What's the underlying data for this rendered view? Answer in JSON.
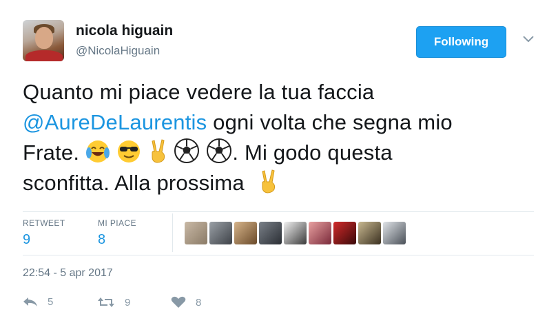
{
  "user": {
    "name": "nicola higuain",
    "handle": "@NicolaHiguain"
  },
  "follow_button": {
    "label": "Following"
  },
  "tweet": {
    "seg1": "Quanto mi piace vedere la tua faccia",
    "mention": "@AureDeLaurentis",
    "seg2": " ogni volta che segna mio",
    "seg3": "Frate.",
    "seg4": ". Mi godo questa",
    "seg5": "sconfitta. Alla prossima"
  },
  "stats": {
    "retweet_label": "RETWEET",
    "retweet_count": "9",
    "like_label": "MI PIACE",
    "like_count": "8"
  },
  "likers": [
    "avatar-1",
    "avatar-2",
    "avatar-3",
    "avatar-4",
    "avatar-5",
    "avatar-6",
    "avatar-7",
    "avatar-8",
    "avatar-9"
  ],
  "timestamp": "22:54 - 5 apr 2017",
  "actions": {
    "reply_count": "5",
    "retweet_count": "9",
    "like_count": "8"
  },
  "colors": {
    "accent": "#1da1f2",
    "link": "#1b95e0",
    "muted": "#657786"
  },
  "icons": [
    "chevron-down-icon",
    "joy-emoji",
    "sunglasses-emoji",
    "victory-hand-emoji",
    "soccer-ball-emoji",
    "reply-icon",
    "retweet-icon",
    "heart-icon"
  ]
}
